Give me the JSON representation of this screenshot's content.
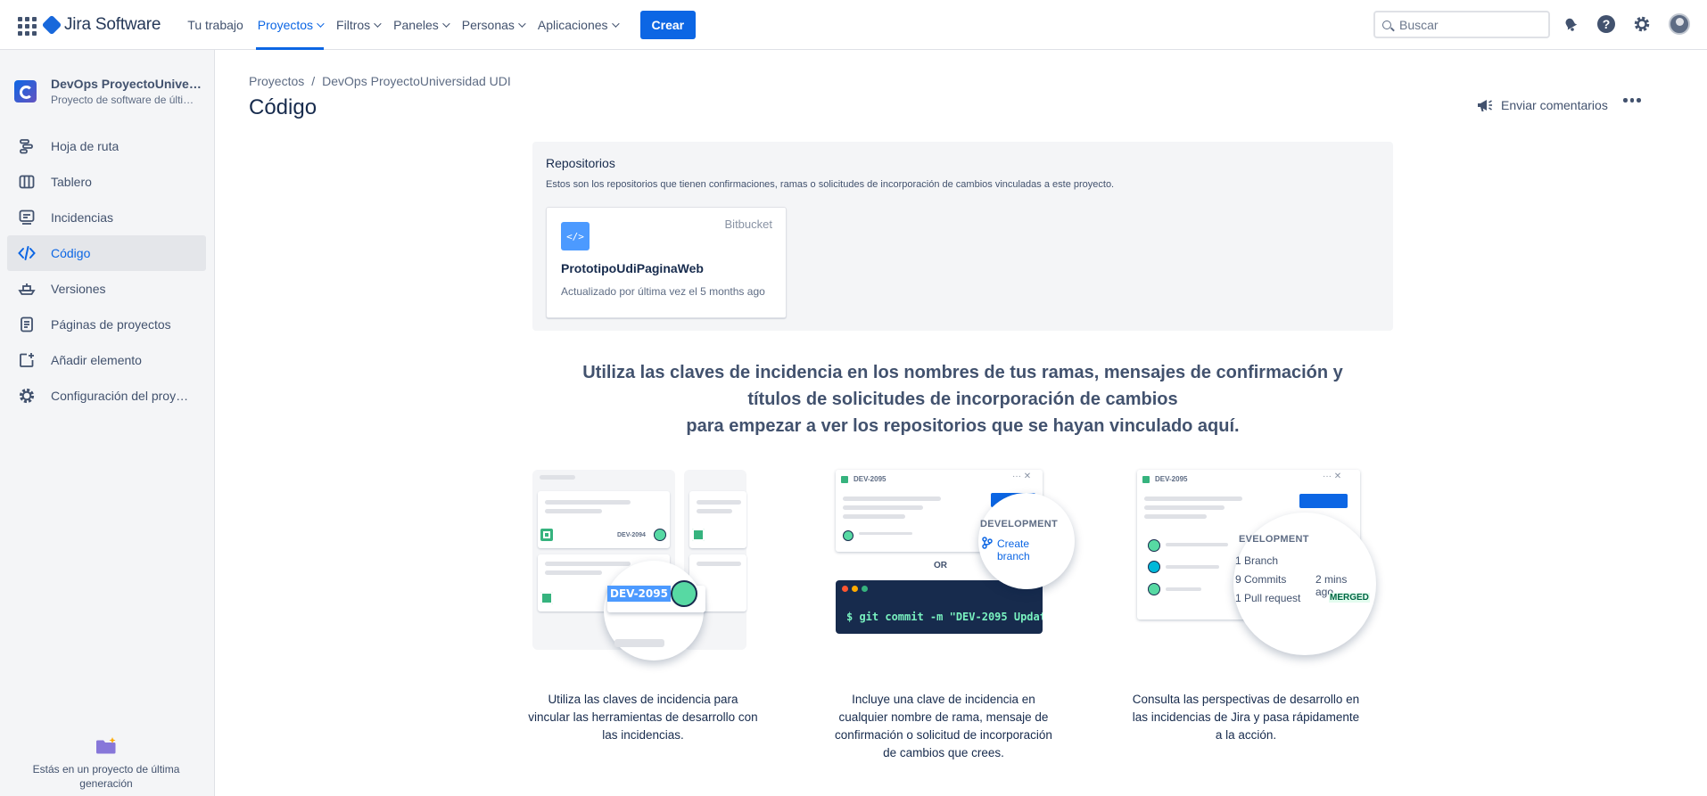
{
  "topnav": {
    "logo_text": "Jira Software",
    "items": [
      {
        "label": "Tu trabajo",
        "dropdown": false,
        "active": false
      },
      {
        "label": "Proyectos",
        "dropdown": true,
        "active": true
      },
      {
        "label": "Filtros",
        "dropdown": true,
        "active": false
      },
      {
        "label": "Paneles",
        "dropdown": true,
        "active": false
      },
      {
        "label": "Personas",
        "dropdown": true,
        "active": false
      },
      {
        "label": "Aplicaciones",
        "dropdown": true,
        "active": false
      }
    ],
    "create_label": "Crear",
    "search_placeholder": "Buscar",
    "accent": "#0c66e4"
  },
  "sidebar": {
    "project_name": "DevOps ProyectoUniversidad UDI",
    "project_type": "Proyecto de software de última generación",
    "items": [
      {
        "label": "Hoja de ruta",
        "icon": "roadmap-icon"
      },
      {
        "label": "Tablero",
        "icon": "board-icon"
      },
      {
        "label": "Incidencias",
        "icon": "issues-icon"
      },
      {
        "label": "Código",
        "icon": "code-icon",
        "active": true
      },
      {
        "label": "Versiones",
        "icon": "ship-icon"
      },
      {
        "label": "Páginas de proyectos",
        "icon": "page-icon"
      },
      {
        "label": "Añadir elemento",
        "icon": "add-item-icon"
      },
      {
        "label": "Configuración del proyecto",
        "icon": "gear-icon"
      }
    ],
    "footer_text": "Estás en un proyecto de última generación"
  },
  "breadcrumb": [
    "Proyectos",
    "/",
    "DevOps ProyectoUniversidad UDI"
  ],
  "page_title": "Código",
  "feedback_label": "Enviar comentarios",
  "repositories": {
    "title": "Repositorios",
    "description": "Estos son los repositorios que tienen confirmaciones, ramas o solicitudes de incorporación de cambios vinculadas a este proyecto.",
    "card": {
      "provider": "Bitbucket",
      "name": "PrototipoUdiPaginaWeb",
      "updated": "Actualizado por última vez el 5 months ago"
    }
  },
  "headline": {
    "line1": "Utiliza las claves de incidencia en los nombres de tus ramas, mensajes de confirmación y títulos de solicitudes de incorporación de cambios",
    "line2": "para empezar a ver los repositorios que se hayan vinculado aquí."
  },
  "features": [
    {
      "text": "Utiliza las claves de incidencia para vincular las herramientas de desarrollo con las incidencias.",
      "illus": {
        "key_small": "DEV-2094",
        "key_large": "DEV-2095"
      }
    },
    {
      "text": "Incluye una clave de incidencia en cualquier nombre de rama, mensaje de confirmación o solicitud de incorporación de cambios que crees.",
      "illus": {
        "key": "DEV-2095",
        "section": "DEVELOPMENT",
        "action": "Create branch",
        "or": "OR",
        "command": "$ git commit -m \"DEV-2095 Updat"
      }
    },
    {
      "text": "Consulta las perspectivas de desarrollo en las incidencias de Jira y pasa rápidamente a la acción.",
      "illus": {
        "key": "DEV-2095",
        "section": "EVELOPMENT",
        "branch": "1 Branch",
        "commits": "9 Commits",
        "commits_time": "2 mins ago",
        "pr": "1 Pull request",
        "pr_status": "MERGED"
      }
    }
  ]
}
